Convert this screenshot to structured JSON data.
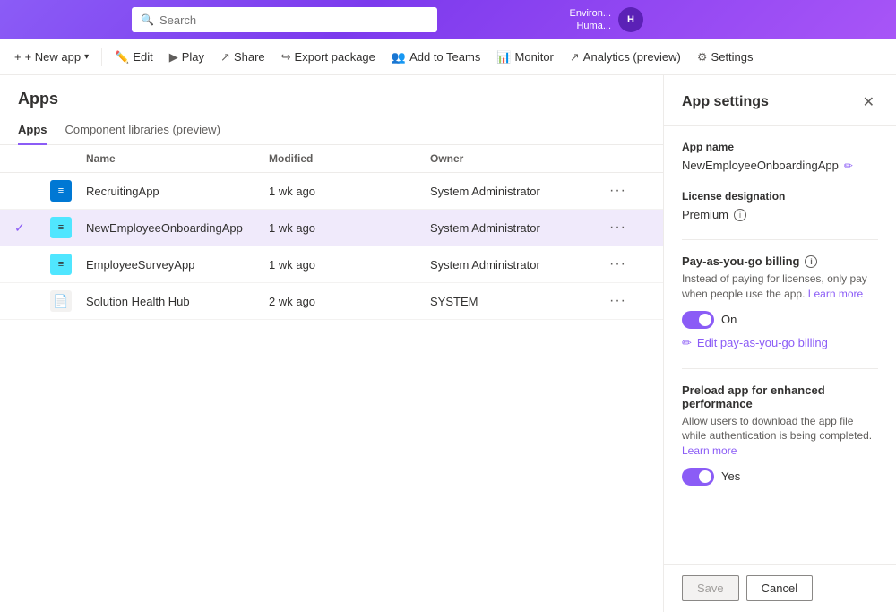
{
  "topBar": {
    "search": {
      "placeholder": "Search"
    },
    "environment": "Environ...",
    "user": "Huma..."
  },
  "commandBar": {
    "newApp": "+ New app",
    "edit": "Edit",
    "play": "Play",
    "share": "Share",
    "exportPackage": "Export package",
    "addToTeams": "Add to Teams",
    "monitor": "Monitor",
    "analytics": "Analytics (preview)",
    "settings": "Settings"
  },
  "page": {
    "title": "Apps",
    "tabs": [
      "Apps",
      "Component libraries (preview)"
    ],
    "activeTab": 0
  },
  "table": {
    "columns": [
      "",
      "",
      "Name",
      "Modified",
      "Owner",
      ""
    ],
    "rows": [
      {
        "id": 1,
        "name": "RecruitingApp",
        "modified": "1 wk ago",
        "owner": "System Administrator",
        "iconType": "blue",
        "iconText": "≡",
        "selected": false
      },
      {
        "id": 2,
        "name": "NewEmployeeOnboardingApp",
        "modified": "1 wk ago",
        "owner": "System Administrator",
        "iconType": "light-blue",
        "iconText": "≡",
        "selected": true
      },
      {
        "id": 3,
        "name": "EmployeeSurveyApp",
        "modified": "1 wk ago",
        "owner": "System Administrator",
        "iconType": "light-blue",
        "iconText": "≡",
        "selected": false
      },
      {
        "id": 4,
        "name": "Solution Health Hub",
        "modified": "2 wk ago",
        "owner": "SYSTEM",
        "iconType": "doc",
        "iconText": "📄",
        "selected": false
      }
    ]
  },
  "appSettings": {
    "title": "App settings",
    "appNameLabel": "App name",
    "appNameValue": "NewEmployeeOnboardingApp",
    "licenseLabel": "License designation",
    "licenseValue": "Premium",
    "payAsYouGoLabel": "Pay-as-you-go billing",
    "payAsYouGoDesc": "Instead of paying for licenses, only pay when people use the app.",
    "payAsYouGoLearnMore": "Learn more",
    "payAsYouGoToggleLabel": "On",
    "payAsYouGoToggleOn": true,
    "editBillingLabel": "Edit pay-as-you-go billing",
    "preloadLabel": "Preload app for enhanced performance",
    "preloadDesc": "Allow users to download the app file while authentication is being completed.",
    "preloadLearnMore": "Learn more",
    "preloadToggleLabel": "Yes",
    "preloadToggleOn": true,
    "saveButton": "Save",
    "cancelButton": "Cancel"
  }
}
